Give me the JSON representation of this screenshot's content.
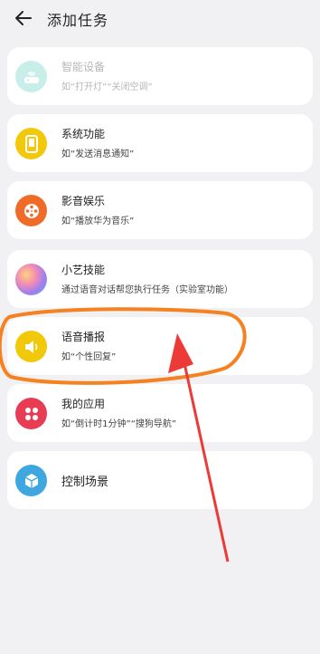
{
  "header": {
    "title": "添加任务"
  },
  "items": [
    {
      "name": "智能设备",
      "desc": "如“打开灯”“关闭空调”",
      "icon": "router-icon",
      "color": "#c8eeea",
      "disabled": true
    },
    {
      "name": "系统功能",
      "desc": "如“发送消息通知”",
      "icon": "phone-icon",
      "color": "#f2c80b"
    },
    {
      "name": "影音娱乐",
      "desc": "如“播放华为音乐”",
      "icon": "film-reel-icon",
      "color": "#ee6b28"
    },
    {
      "name": "小艺技能",
      "desc": "通过语音对话帮您执行任务（实验室功能）",
      "icon": "xiaoyi-orb-icon",
      "color": "#c59be6"
    },
    {
      "name": "语音播报",
      "desc": "如“个性回复”",
      "icon": "speaker-icon",
      "color": "#f2c80b"
    },
    {
      "name": "我的应用",
      "desc": "如“倒计时1分钟”“搜狗导航”",
      "icon": "apps-grid-icon",
      "color": "#e83c55"
    },
    {
      "name": "控制场景",
      "icon": "cube-icon",
      "color": "#3fa7e0"
    }
  ],
  "annotation": {
    "highlight_color": "#f58120",
    "arrow_color": "#ec3b36"
  }
}
